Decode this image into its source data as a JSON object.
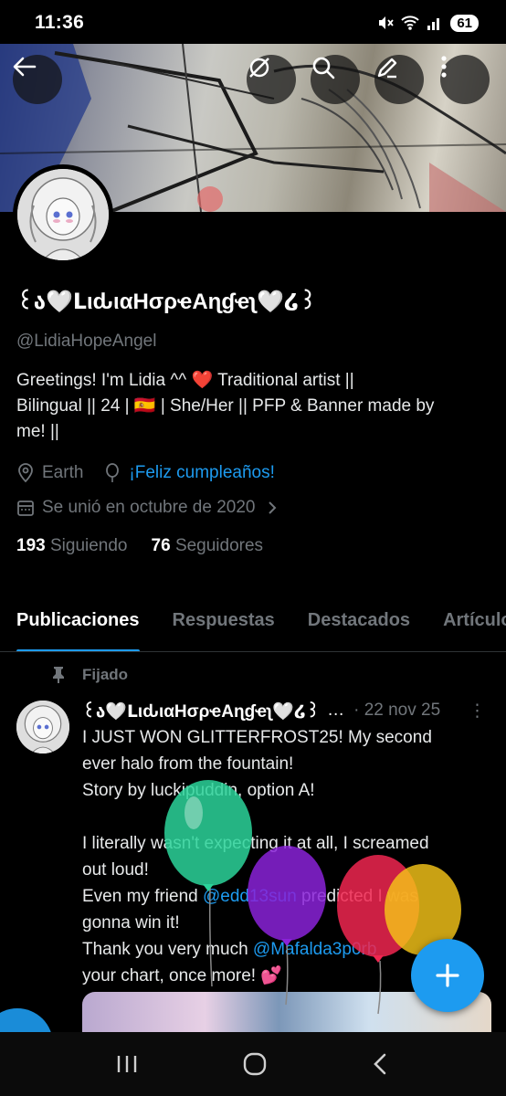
{
  "status_bar": {
    "time": "11:36",
    "battery": "61"
  },
  "profile": {
    "display_name": "꒰ა🤍ᒪιԃιαHσρҽAɳɠҽʅ🤍໒꒱",
    "handle": "@LidiaHopeAngel",
    "bio_line1": "Greetings! I'm Lidia ^^ ❤️ Traditional artist ||",
    "bio_line2": "Bilingual || 24 | 🇪🇸 | She/Her || PFP & Banner made by",
    "bio_line3": "me! ||",
    "location": "Earth",
    "birthday_link": "¡Feliz cumpleaños!",
    "joined": "Se unió en octubre de 2020",
    "following_count": "193",
    "following_label": "Siguiendo",
    "followers_count": "76",
    "followers_label": "Seguidores"
  },
  "tabs": [
    {
      "label": "Publicaciones",
      "active": true
    },
    {
      "label": "Respuestas"
    },
    {
      "label": "Destacados"
    },
    {
      "label": "Artículos"
    }
  ],
  "pinned_post": {
    "pinned_label": "Fijado",
    "author": "꒰ა🤍ᒪιԃιαHσρҽAɳɠҽʅ🤍໒꒱",
    "ellipsis": "…",
    "date": "· 22 nov 25",
    "more": "⋮",
    "line1": "I JUST WON GLITTERFROST25! My second",
    "line2": "ever halo from the fountain!",
    "line3": "Story by luckipuddin, option A!",
    "line4": "I literally wasn't expecting it at all, I screamed",
    "line5": "out loud!",
    "line6_before": "Even my friend ",
    "line6_mention": "@edd13sun",
    "line6_after": " predicted I was",
    "line7": "gonna win it!",
    "line8_before": "Thank you very much ",
    "line8_mention": "@Mafalda3p0rb",
    "line9": "your chart, once more! 💕"
  },
  "colors": {
    "accent": "#1d9bf0",
    "muted": "#71767b",
    "background": "#000000"
  },
  "icons": [
    "back-arrow-icon",
    "grok-icon",
    "search-icon",
    "edit-icon",
    "more-vertical-icon",
    "location-icon",
    "balloon-icon",
    "calendar-icon",
    "chevron-right-icon",
    "pin-icon",
    "plus-icon",
    "recents-icon",
    "home-icon",
    "back-icon"
  ]
}
